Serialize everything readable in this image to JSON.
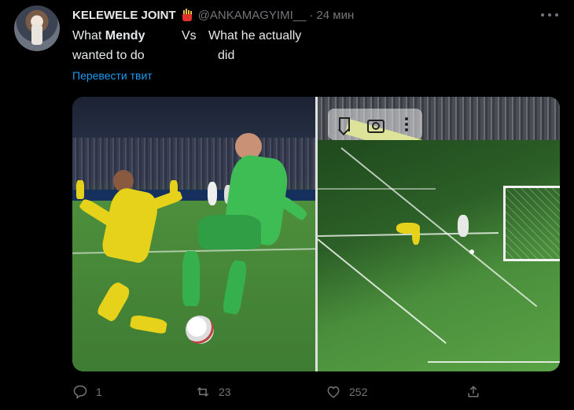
{
  "tweet": {
    "display_name": "KELEWELE JOINT",
    "name_emoji": "fries-emoji",
    "handle": "@ANKAMAGYIMI__",
    "separator": "·",
    "time": "24 мин",
    "text": {
      "line1_a": "What ",
      "line1_b": "Mendy",
      "line1_vs": "Vs",
      "line1_c": "What he actually",
      "line2_a": "wanted to do",
      "line2_c": "did"
    },
    "translate_label": "Перевести твит",
    "media": {
      "toolbar": [
        "bookmark-icon",
        "camera-icon",
        "more-vertical-icon"
      ]
    }
  },
  "actions": {
    "reply_count": "1",
    "retweet_count": "23",
    "like_count": "252"
  },
  "colors": {
    "background": "#000000",
    "text": "#e7e9ea",
    "secondary": "#71767b",
    "link": "#1d9bf0"
  }
}
